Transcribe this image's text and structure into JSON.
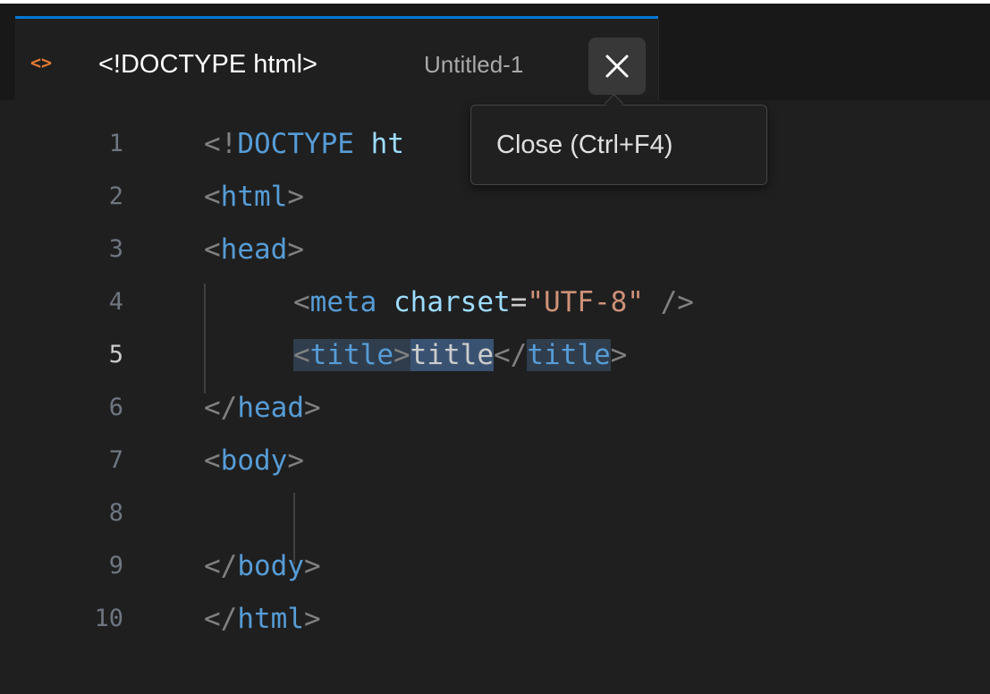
{
  "tab": {
    "icon": "html-file-icon",
    "title": "<!DOCTYPE html>",
    "description": "Untitled-1",
    "close_glyph": "×"
  },
  "tooltip": {
    "text": "Close (Ctrl+F4)"
  },
  "colors": {
    "tab_active_border": "#0078d4",
    "html_icon": "#e37933",
    "tag": "#569cd6",
    "attribute": "#9cdcfe",
    "string": "#ce9178",
    "punctuation": "#808080",
    "selection_highlight": "#3a5272"
  },
  "editor": {
    "active_line": 5,
    "lines": [
      {
        "number": "1",
        "tokens": {
          "t1": "<!",
          "t2": "DOCTYPE",
          "t3": "ht"
        }
      },
      {
        "number": "2",
        "tokens": {
          "t1": "<",
          "t2": "html",
          "t3": ">"
        }
      },
      {
        "number": "3",
        "tokens": {
          "t1": "<",
          "t2": "head",
          "t3": ">"
        }
      },
      {
        "number": "4",
        "tokens": {
          "t1": "<",
          "t2": "meta",
          "t3": " ",
          "t4": "charset",
          "t5": "=",
          "t6": "\"UTF-8\"",
          "t7": " />"
        }
      },
      {
        "number": "5",
        "tokens": {
          "t1": "<",
          "t2": "title",
          "t3": ">",
          "t4": "title",
          "t5": "</",
          "t6": "title",
          "t7": ">"
        }
      },
      {
        "number": "6",
        "tokens": {
          "t1": "</",
          "t2": "head",
          "t3": ">"
        }
      },
      {
        "number": "7",
        "tokens": {
          "t1": "<",
          "t2": "body",
          "t3": ">"
        }
      },
      {
        "number": "8",
        "tokens": {}
      },
      {
        "number": "9",
        "tokens": {
          "t1": "</",
          "t2": "body",
          "t3": ">"
        }
      },
      {
        "number": "10",
        "tokens": {
          "t1": "</",
          "t2": "html",
          "t3": ">"
        }
      }
    ]
  }
}
